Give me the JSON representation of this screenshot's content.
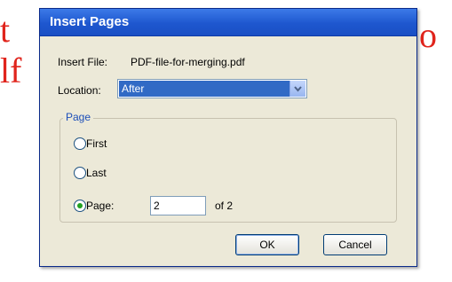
{
  "background": {
    "left_fragment_1": "t",
    "left_fragment_2": "lf",
    "right_fragment_1": "o",
    "text_color": "#e0241c"
  },
  "dialog": {
    "title": "Insert Pages",
    "insert_file_label": "Insert File:",
    "insert_file_value": "PDF-file-for-merging.pdf",
    "location_label": "Location:",
    "location_value": "After",
    "page_group_title": "Page",
    "options": {
      "first_label": "First",
      "last_label": "Last",
      "page_label": "Page:",
      "selected": "Page"
    },
    "page_number_value": "2",
    "of_label": "of 2",
    "ok_label": "OK",
    "cancel_label": "Cancel"
  },
  "colors": {
    "titlebar": "#2a63d9",
    "dialog_bg": "#ece9d8",
    "group_title": "#1c4fb9",
    "selection": "#316ac5"
  }
}
